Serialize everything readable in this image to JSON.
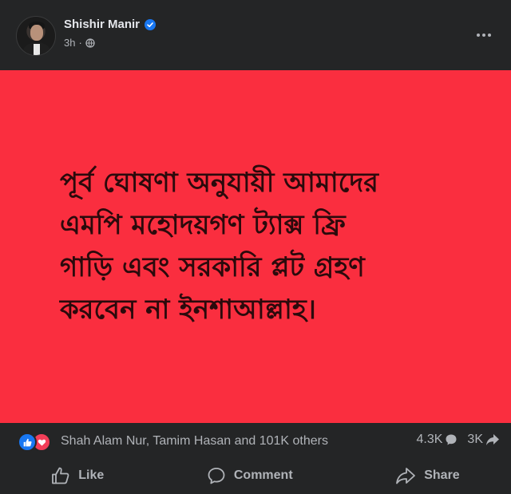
{
  "post": {
    "author": "Shishir Manir",
    "time": "3h",
    "privacy_icon": "globe-icon",
    "verified_icon": "verified-badge-icon",
    "more_icon": "more-options-icon",
    "background_color": "#fa2e3f",
    "text": "পূর্ব ঘোষণা অনুযায়ী আমাদের\nএমপি মহোদয়গণ ট্যাক্স ফ্রি\nগাড়ি এবং সরকারি প্লট গ্রহণ\nকরবেন না ইনশাআল্লাহ।"
  },
  "reactions": {
    "icons": [
      "like-reaction-icon",
      "love-reaction-icon"
    ],
    "summary": "Shah Alam Nur, Tamim Hasan and 101K others",
    "comments_count": "4.3K",
    "shares_count": "3K"
  },
  "actions": {
    "like": "Like",
    "comment": "Comment",
    "share": "Share"
  }
}
